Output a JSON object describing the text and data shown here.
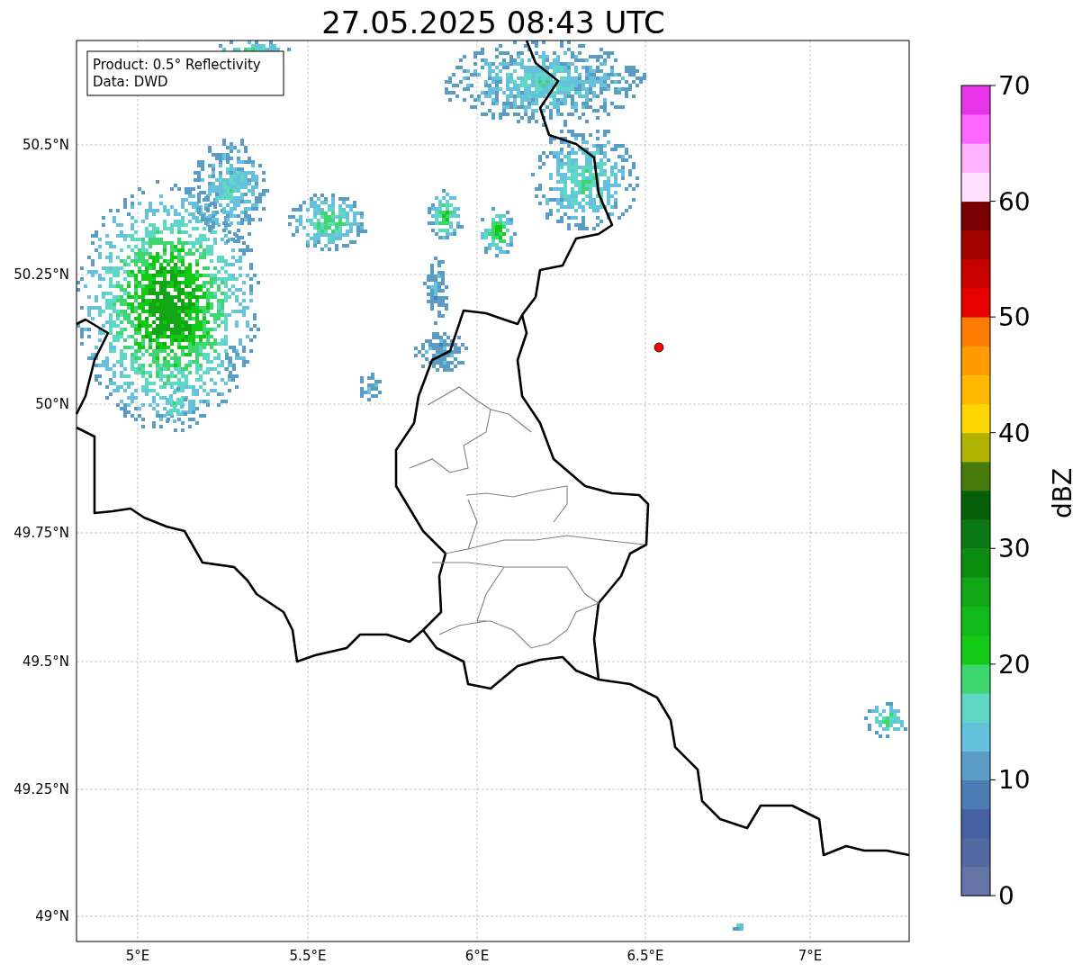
{
  "title": "27.05.2025 08:43 UTC",
  "legend": {
    "lines": [
      "Product: 0.5° Reflectivity",
      "Data: DWD"
    ]
  },
  "map": {
    "latitude_labels": [
      "50.5°N",
      "50.25°N",
      "50°N",
      "49.75°N",
      "49.5°N",
      "49.25°N",
      "49°N"
    ],
    "longitude_labels": [
      "5°E",
      "5.5°E",
      "6°E",
      "6.5°E",
      "7°E"
    ]
  },
  "colorbar": {
    "label": "dBZ",
    "ticks": [
      "70",
      "60",
      "50",
      "40",
      "30",
      "20",
      "10",
      "0"
    ],
    "bands": [
      {
        "color": "#6475a6"
      },
      {
        "color": "#5367a0"
      },
      {
        "color": "#4560a3"
      },
      {
        "color": "#4b7bb2"
      },
      {
        "color": "#5b9cc4"
      },
      {
        "color": "#66c2dc"
      },
      {
        "color": "#5ed8c4"
      },
      {
        "color": "#3dd66f"
      },
      {
        "color": "#12c916"
      },
      {
        "color": "#11b91a"
      },
      {
        "color": "#10a615"
      },
      {
        "color": "#0d8c12"
      },
      {
        "color": "#0a7812"
      },
      {
        "color": "#085f0a"
      },
      {
        "color": "#467a0a"
      },
      {
        "color": "#b0b400"
      },
      {
        "color": "#ffd700"
      },
      {
        "color": "#ffb800"
      },
      {
        "color": "#ff9b00"
      },
      {
        "color": "#ff7c00"
      },
      {
        "color": "#e60000"
      },
      {
        "color": "#c80000"
      },
      {
        "color": "#a00000"
      },
      {
        "color": "#780000"
      },
      {
        "color": "#ffe0ff"
      },
      {
        "color": "#ffb3ff"
      },
      {
        "color": "#ff66ff"
      },
      {
        "color": "#e833e8"
      }
    ]
  }
}
